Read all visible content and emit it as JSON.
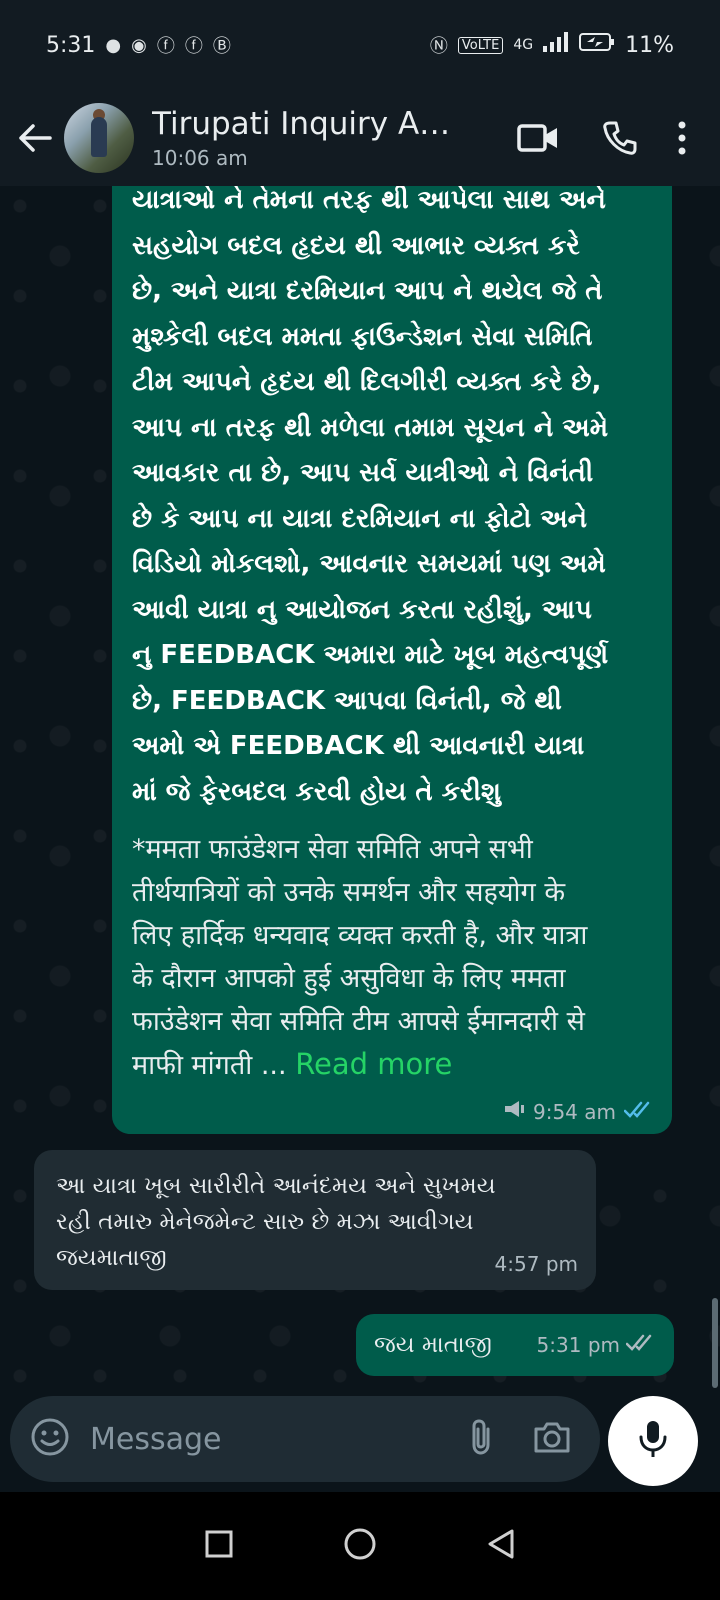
{
  "status_bar": {
    "time": "5:31",
    "network": "VoLTE",
    "signal": "4G",
    "battery": "11%",
    "notification_icons": [
      "chat-icon",
      "whatsapp-icon",
      "facebook-icon",
      "facebook-icon",
      "b-icon"
    ]
  },
  "header": {
    "contact_name": "Tirupati Inquiry An...",
    "last_seen": "10:06 am"
  },
  "messages": [
    {
      "direction": "outgoing",
      "gujarati_lines": [
        "યાત્રાઓ ને તેમના તરફ થી આપેલા સાથ અને",
        "સહયોગ બદલ હૃદય થી આભાર વ્યક્ત કરે",
        "છે, અને યાત્રા દરમિયાન આપ ને થયેલ જે તે",
        "મુશ્કેલી બદલ મમતા ફાઉન્ડેશન સેવા સમિતિ",
        "ટીમ આપને હૃદય થી દિલગીરી વ્યક્ત કરે છે,",
        "આપ ના તરફ થી મળેલા તમામ સૂચન ને અમે",
        "આવકાર તા છે, આપ સર્વ યાત્રીઓ ને વિનંતી",
        "છે કે આપ ના યાત્રા દરમિયાન ના ફોટો અને",
        "વિડિયો મોકલશો, આવનાર સમયમાં પણ અમે",
        "આવી યાત્રા નુ આયોજન કરતા રહીશું, આપ",
        "નુ FEEDBACK અમારા માટે ખૂબ મહત્વપૂર્ણ",
        "છે, FEEDBACK આપવા વિનંતી, જે થી",
        "અમો એ FEEDBACK થી આવનારી યાત્રા",
        "માં જે ફેરબદલ કરવી હોય તે કરીશુ"
      ],
      "hindi_lines": [
        " *ममता फाउंडेशन सेवा समिति अपने सभी",
        "तीर्थयात्रियों को उनके समर्थन और सहयोग के",
        "लिए हार्दिक धन्यवाद व्यक्त करती है, और यात्रा",
        "के दौरान आपको हुई असुविधा के लिए ममता",
        "फाउंडेशन सेवा समिति टीम आपसे ईमानदारी से"
      ],
      "hindi_last_line": "माफी मांगती ...",
      "read_more": "Read more",
      "time": "9:54 am"
    },
    {
      "direction": "incoming",
      "lines": [
        "આ યાત્રા ખૂબ સારીરીતે આનંદમય અને સુખમય",
        "રહી તમારુ મેનેજમેન્ટ સારુ છે મઝા આવીગય",
        "જયમાતાજી"
      ],
      "time": "4:57 pm"
    },
    {
      "direction": "outgoing",
      "text": "જય માતાજી",
      "time": "5:31 pm"
    }
  ],
  "composer": {
    "placeholder": "Message"
  },
  "colors": {
    "outgoing_bubble": "#005c4b",
    "incoming_bubble": "#202c33",
    "background": "#0b141a",
    "read_receipt": "#53bdeb",
    "link": "#25d366"
  }
}
